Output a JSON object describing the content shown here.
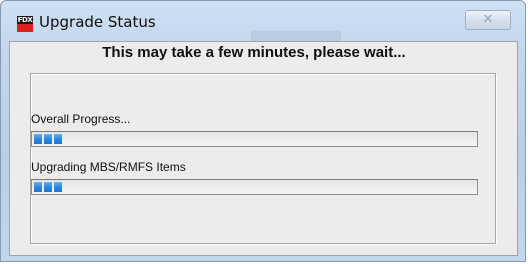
{
  "window": {
    "title": "Upgrade Status",
    "app_icon_text": "FDX",
    "close_glyph": "✕"
  },
  "dialog": {
    "headline": "This may take a few minutes, please wait...",
    "overall": {
      "label": "Overall Progress...",
      "progress": 0.06
    },
    "items": {
      "label": "Upgrading MBS/RMFS Items",
      "progress": 0.06
    }
  },
  "colors": {
    "progress_fill": "#2b86e0",
    "titlebar": "#c3d6ec",
    "client_bg": "#ececec"
  }
}
